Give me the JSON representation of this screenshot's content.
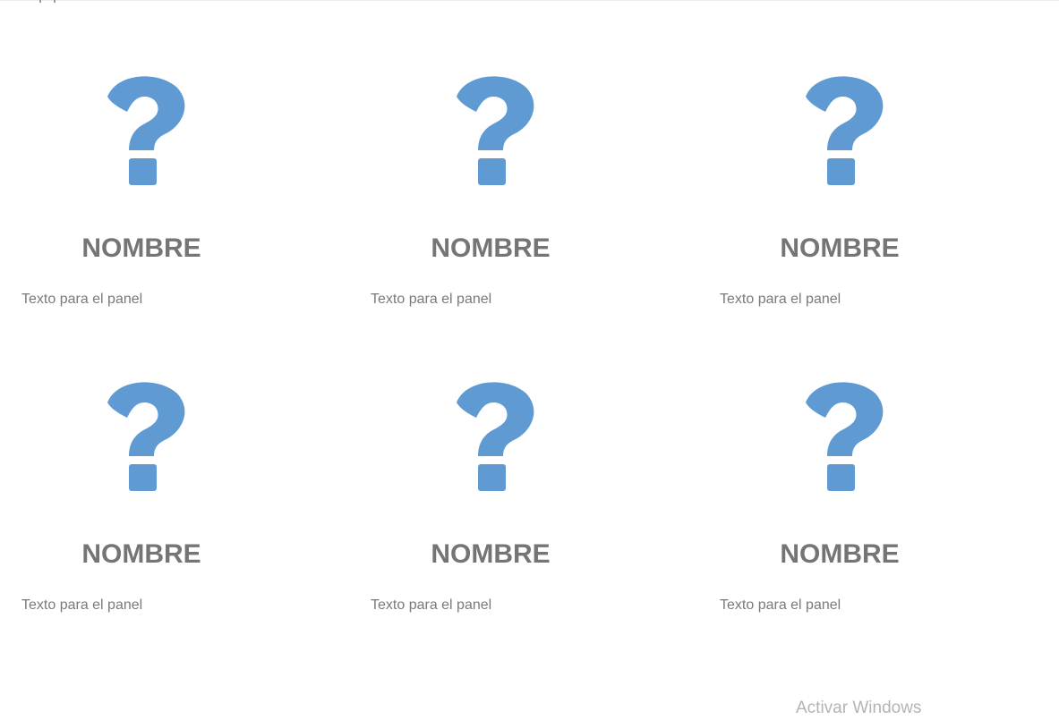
{
  "colors": {
    "icon": "#5f9bd2",
    "name_text": "#757575",
    "body_text": "#7a7a7a",
    "watermark": "#b4b4b4"
  },
  "panels": [
    {
      "icon": "question-mark-icon",
      "name": "NOMBRE",
      "text": "Texto para el panel"
    },
    {
      "icon": "question-mark-icon",
      "name": "NOMBRE",
      "text": "Texto para el panel"
    },
    {
      "icon": "question-mark-icon",
      "name": "NOMBRE",
      "text": "Texto para el panel"
    },
    {
      "icon": "question-mark-icon",
      "name": "NOMBRE",
      "text": "Texto para el panel"
    },
    {
      "icon": "question-mark-icon",
      "name": "NOMBRE",
      "text": "Texto para el panel"
    },
    {
      "icon": "question-mark-icon",
      "name": "NOMBRE",
      "text": "Texto para el panel"
    }
  ],
  "watermark": "Activar Windows"
}
